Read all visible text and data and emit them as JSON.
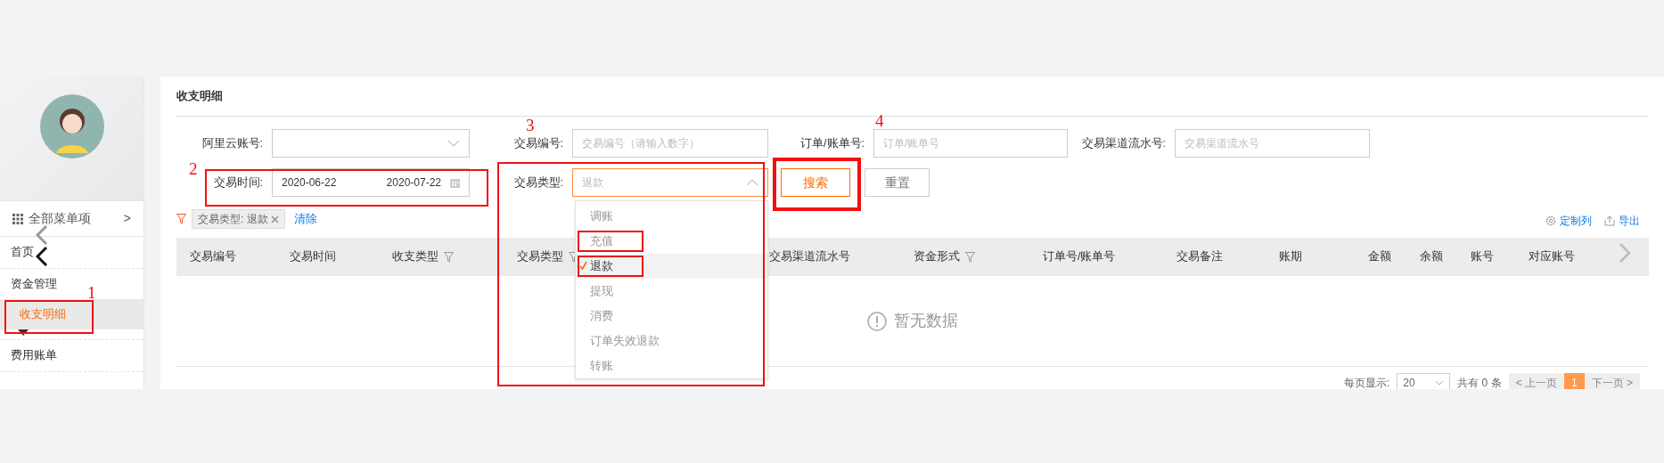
{
  "sidebar": {
    "menu_header": {
      "label": "全部菜单项",
      "arrow": ">"
    },
    "items": [
      {
        "label": "首页",
        "kind": "item",
        "selected": false
      },
      {
        "label": "资金管理",
        "kind": "group",
        "selected": false
      },
      {
        "label": "收支明细",
        "kind": "sub",
        "selected": true
      },
      {
        "label": "费用账单",
        "kind": "item",
        "selected": false
      }
    ]
  },
  "page_title": "收支明细",
  "filters": [
    {
      "label": "阿里云账号:",
      "kind": "select"
    },
    {
      "label": "交易编号:",
      "kind": "input",
      "placeholder": "交易编号（请输入数字）"
    },
    {
      "label": "订单/账单号:",
      "kind": "input",
      "placeholder": "订单/账单号"
    },
    {
      "label": "交易渠道流水号:",
      "kind": "input",
      "placeholder": "交易渠道流水号"
    },
    {
      "label": "交易时间:",
      "kind": "daterange",
      "start": "2020-06-22",
      "end": "2020-07-22"
    },
    {
      "label": "交易类型:",
      "kind": "select",
      "placeholder": "退款",
      "expanded": true
    }
  ],
  "buttons": [
    {
      "label": "搜索",
      "primary": true
    },
    {
      "label": "重置",
      "primary": false
    }
  ],
  "active_filters": [
    {
      "label": "交易类型: 退款"
    }
  ],
  "clear_link": "清除",
  "toolbar": [
    {
      "label": "定制列",
      "kind": "settings"
    },
    {
      "label": "导出",
      "kind": "export"
    }
  ],
  "dropdown": [
    {
      "label": "调账",
      "selected": false,
      "annotated": false
    },
    {
      "label": "充值",
      "selected": false,
      "annotated": true
    },
    {
      "label": "退款",
      "selected": true,
      "annotated": true
    },
    {
      "label": "提现",
      "selected": false,
      "annotated": false
    },
    {
      "label": "消费",
      "selected": false,
      "annotated": false
    },
    {
      "label": "订单失效退款",
      "selected": false,
      "annotated": false
    },
    {
      "label": "转账",
      "selected": false,
      "annotated": false
    }
  ],
  "table": {
    "columns": [
      {
        "label": "交易编号",
        "filter": false
      },
      {
        "label": "交易时间",
        "filter": false
      },
      {
        "label": "收支类型",
        "filter": true
      },
      {
        "label": "交易类型",
        "filter": true
      },
      {
        "label": "交易渠道流水号",
        "filter": false
      },
      {
        "label": "资金形式",
        "filter": true
      },
      {
        "label": "订单号/账单号",
        "filter": false
      },
      {
        "label": "交易备注",
        "filter": false
      },
      {
        "label": "账期",
        "filter": false
      },
      {
        "label": "金额",
        "filter": false
      },
      {
        "label": "余额",
        "filter": false
      },
      {
        "label": "账号",
        "filter": false
      },
      {
        "label": "对应账号",
        "filter": false
      }
    ],
    "empty_text": "暂无数据"
  },
  "pagination": {
    "page_size_label": "每页显示:",
    "page_size": "20",
    "total": "共有 0 条",
    "prev": "< 上一页",
    "pages": [
      {
        "label": "1",
        "selected": true
      }
    ],
    "next": "下一页 >"
  },
  "annotations": [
    {
      "kind": "numbered",
      "label": "1"
    },
    {
      "kind": "numbered",
      "label": "2"
    },
    {
      "kind": "numbered",
      "label": "3"
    },
    {
      "kind": "numbered",
      "label": "4"
    }
  ]
}
